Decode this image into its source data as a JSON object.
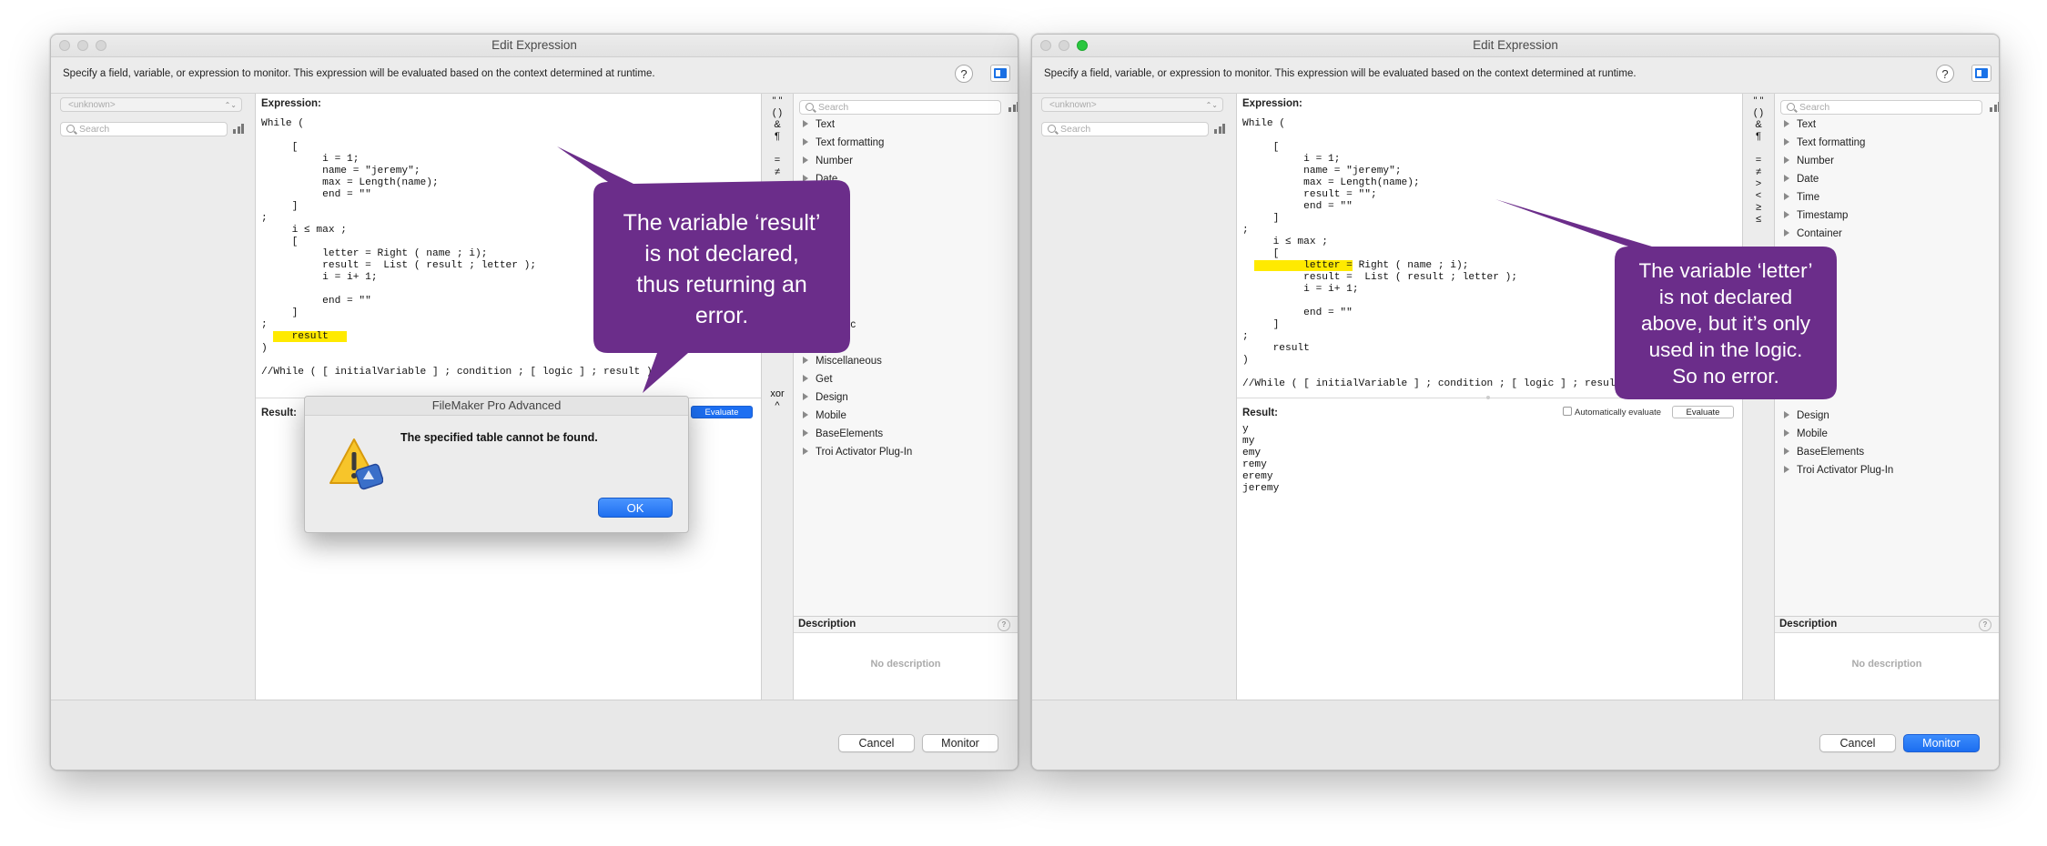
{
  "window_title": "Edit Expression",
  "info_text": "Specify a field, variable, or expression to monitor. This expression will be evaluated based on the context determined at runtime.",
  "help_glyph": "?",
  "table_popup": "<unknown>",
  "search_placeholder": "Search",
  "expression_label": "Expression:",
  "result_label": "Result:",
  "evaluate_label": "Evaluate",
  "auto_evaluate_label": "Automatically evaluate",
  "operators_left": [
    "\" \"",
    "( )",
    "&",
    "¶",
    "",
    "=",
    "≠",
    ">",
    "<",
    "≥",
    "≤",
    "",
    "",
    "",
    "",
    "",
    "",
    "",
    "",
    "",
    "",
    "",
    "",
    "",
    "xor",
    "^"
  ],
  "operators_right": [
    "\" \"",
    "( )",
    "&",
    "¶",
    "",
    "=",
    "≠",
    ">",
    "<",
    "≥",
    "≤"
  ],
  "function_categories": [
    "Text",
    "Text formatting",
    "Number",
    "Date",
    "Time",
    "Timestamp",
    "Container",
    "Json",
    "Repeating",
    "Summary",
    "Aggregate",
    "Financial",
    "Trigonometric",
    "Logical",
    "Miscellaneous",
    "Get",
    "Design",
    "Mobile",
    "BaseElements",
    "Troi Activator Plug-In"
  ],
  "function_categories_left_visible": [
    "Text",
    "Text formatting",
    "Number",
    "Date",
    "stamp",
    "ner",
    "se",
    "",
    "gate",
    "ting",
    "cial",
    "nometric",
    "Logical",
    "Miscellaneous",
    "Get",
    "Design",
    "Mobile",
    "BaseElements",
    "Troi Activator Plug-In"
  ],
  "function_categories_right_visible": [
    "Text",
    "Text formatting",
    "Number",
    "Date",
    "Time",
    "Timestamp",
    "Container",
    "e",
    "",
    "te",
    "ng",
    "l",
    "metric",
    "",
    "aneous",
    "",
    "Design",
    "Mobile",
    "BaseElements",
    "Troi Activator Plug-In"
  ],
  "description_label": "Description",
  "no_description": "No description",
  "cancel_label": "Cancel",
  "monitor_label": "Monitor",
  "left_window": {
    "code_before": "While (\n\n     [\n          i = 1;\n          name = \"jeremy\";\n          max = Length(name);\n          end = \"\"\n     ]\n;\n     i ≤ max ;\n     [\n          letter = Right ( name ; i);\n          result =  List ( result ; letter );\n          i = i+ 1;\n\n          end = \"\"\n     ]\n;\n  ",
    "code_highlight": "   result   ",
    "code_after": "\n)\n\n//While ( [ initialVariable ] ; condition ; [ logic ] ; result )",
    "alert": {
      "title": "FileMaker Pro Advanced",
      "message": "The specified table cannot be found.",
      "ok_label": "OK"
    },
    "callout": [
      "The variable ‘result’",
      "is not declared,",
      "thus returning an",
      "error."
    ]
  },
  "right_window": {
    "code_before": "While (\n\n     [\n          i = 1;\n          name = \"jeremy\";\n          max = Length(name);\n          result = \"\";\n          end = \"\"\n     ]\n;\n     i ≤ max ;\n     [\n  ",
    "code_highlight": "        letter =",
    "code_after": " Right ( name ; i);\n          result =  List ( result ; letter );\n          i = i+ 1;\n\n          end = \"\"\n     ]\n;\n     result\n)\n\n//While ( [ initialVariable ] ; condition ; [ logic ] ; result",
    "result_text": "y\nmy\nemy\nremy\neremy\njeremy",
    "callout": [
      "The variable ‘letter’",
      "is not declared",
      "above, but it’s only",
      "used in the logic.",
      "So no error."
    ]
  },
  "colors": {
    "callout_purple": "#6b2d8a",
    "highlight_yellow": "#ffea00",
    "accent_blue": "#1d6ff2",
    "traffic_green": "#2ac73f"
  }
}
